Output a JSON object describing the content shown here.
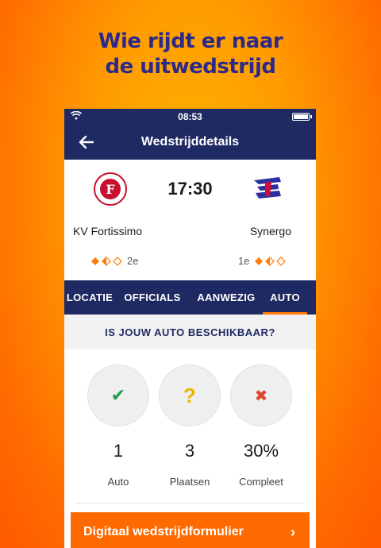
{
  "headline": {
    "line1": "Wie rijdt er naar",
    "line2": "de uitwedstrijd"
  },
  "statusbar": {
    "time": "08:53"
  },
  "navbar": {
    "title": "Wedstrijddetails"
  },
  "match": {
    "time": "17:30",
    "home": {
      "name": "KV Fortissimo",
      "rank": "2e",
      "logo_letter": "F"
    },
    "away": {
      "name": "Synergo",
      "rank": "1e"
    }
  },
  "tabs": [
    {
      "label": "LOCATIE"
    },
    {
      "label": "OFFICIALS"
    },
    {
      "label": "AANWEZIG"
    },
    {
      "label": "AUTO"
    }
  ],
  "question": "IS JOUW AUTO BESCHIKBAAR?",
  "options": {
    "yes_symbol": "✔",
    "maybe_symbol": "?",
    "no_symbol": "✖"
  },
  "stats": [
    {
      "value": "1",
      "label": "Auto"
    },
    {
      "value": "3",
      "label": "Plaatsen"
    },
    {
      "value": "30%",
      "label": "Compleet"
    }
  ],
  "form_button": {
    "label": "Digitaal wedstrijdformulier",
    "chevron": "›"
  },
  "colors": {
    "navy": "#1f2a63",
    "orange": "#ff6a00",
    "green": "#1e9e4a",
    "yellow": "#f0b400",
    "red": "#e0462f"
  }
}
